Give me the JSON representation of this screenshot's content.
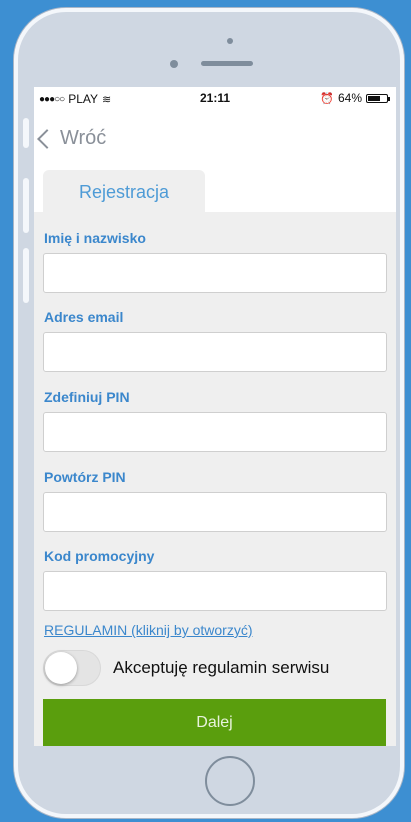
{
  "status_bar": {
    "signal": "●●●○○",
    "carrier": "PLAY",
    "wifi_glyph": "≋",
    "time": "21:11",
    "alarm_glyph": "⏰",
    "battery": "64%",
    "battery_level": 0.64
  },
  "nav": {
    "back_label": "Wróć"
  },
  "tab": {
    "label": "Rejestracja"
  },
  "form": {
    "fields": [
      {
        "label": "Imię i nazwisko",
        "value": ""
      },
      {
        "label": "Adres email",
        "value": ""
      },
      {
        "label": "Zdefiniuj PIN",
        "value": ""
      },
      {
        "label": "Powtórz PIN",
        "value": ""
      },
      {
        "label": "Kod promocyjny",
        "value": ""
      }
    ],
    "terms_link": "REGULAMIN (kliknij by otworzyć)",
    "accept_toggle": {
      "label": "Akceptuję regulamin serwisu",
      "checked": false
    },
    "submit_label": "Dalej"
  },
  "colors": {
    "background": "#3d8fd2",
    "accent": "#3b87cc",
    "button": "#5a9e0d",
    "form_bg": "#efefef"
  }
}
